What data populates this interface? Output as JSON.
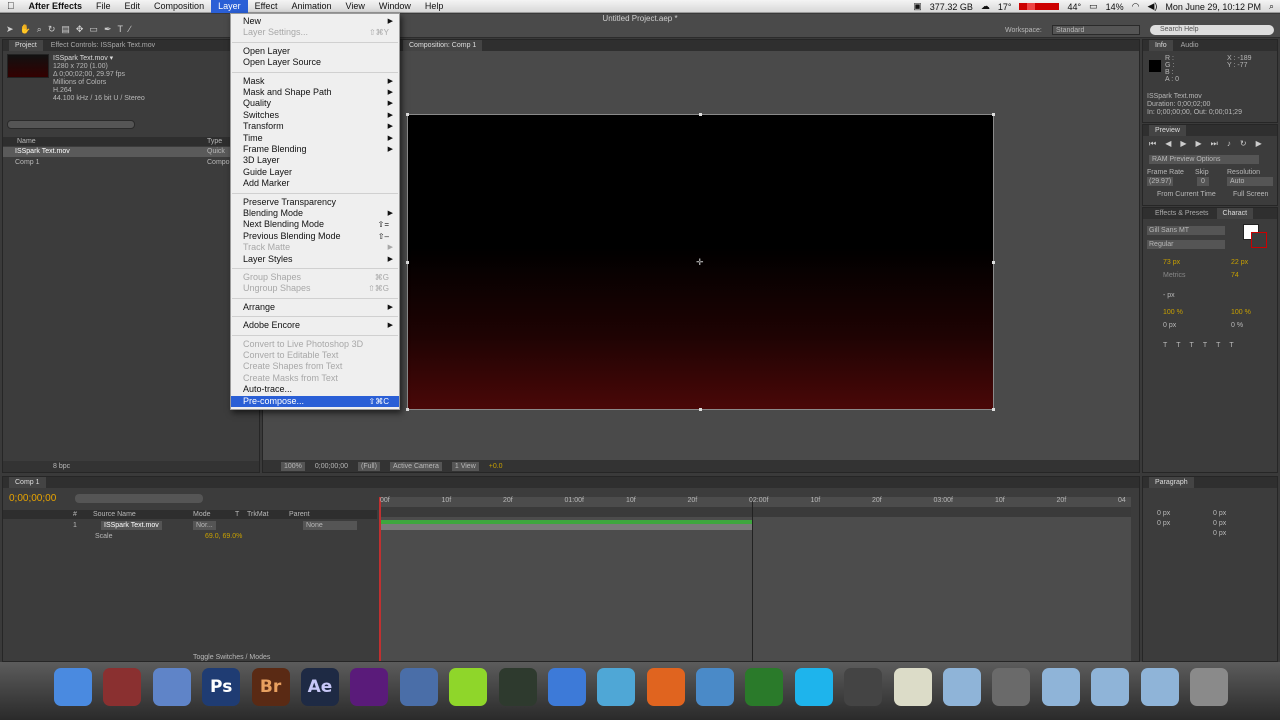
{
  "menubar": {
    "apple": "",
    "items": [
      "After Effects",
      "File",
      "Edit",
      "Composition",
      "Layer",
      "Effect",
      "Animation",
      "View",
      "Window",
      "Help"
    ],
    "active_index": 4,
    "disk": "377.32 GB",
    "temp": "17°",
    "temp2": "44°",
    "battery": "14%",
    "clock": "Mon June 29, 10:12 PM"
  },
  "toolbar": {
    "doc_title": "Untitled Project.aep *",
    "workspace_label": "Workspace:",
    "workspace_value": "Standard",
    "search_placeholder": "Search Help"
  },
  "project_panel": {
    "tab1": "Project",
    "tab2": "Effect Controls: ISSpark Text.mov",
    "asset_name": "ISSpark Text.mov ▾",
    "asset_info": [
      "1280 x 720 (1.00)",
      "Δ 0;00;02;00, 29.97 fps",
      "Millions of Colors",
      "H.264",
      "44.100 kHz / 16 bit U / Stereo"
    ],
    "col_name": "Name",
    "col_type": "Type",
    "items": [
      {
        "name": "ISSpark Text.mov",
        "type": "Quick"
      },
      {
        "name": "Comp 1",
        "type": "Compo"
      }
    ],
    "bpc": "8 bpc"
  },
  "comp_panel": {
    "tab": "Composition: Comp 1",
    "zoom": "100%",
    "timecode": "0;00;00;00",
    "resolution": "(Full)",
    "camera": "Active Camera",
    "view": "1 View",
    "offset": "+0.0"
  },
  "layer_menu": {
    "items": [
      {
        "label": "New",
        "sub": true
      },
      {
        "label": "Layer Settings...",
        "shortcut": "⇧⌘Y",
        "disabled": true
      },
      {
        "sep": true
      },
      {
        "label": "Open Layer"
      },
      {
        "label": "Open Layer Source"
      },
      {
        "sep": true
      },
      {
        "label": "Mask",
        "sub": true
      },
      {
        "label": "Mask and Shape Path",
        "sub": true
      },
      {
        "label": "Quality",
        "sub": true
      },
      {
        "label": "Switches",
        "sub": true
      },
      {
        "label": "Transform",
        "sub": true
      },
      {
        "label": "Time",
        "sub": true
      },
      {
        "label": "Frame Blending",
        "sub": true
      },
      {
        "label": "3D Layer"
      },
      {
        "label": "Guide Layer"
      },
      {
        "label": "Add Marker"
      },
      {
        "sep": true
      },
      {
        "label": "Preserve Transparency"
      },
      {
        "label": "Blending Mode",
        "sub": true
      },
      {
        "label": "Next Blending Mode",
        "shortcut": "⇧="
      },
      {
        "label": "Previous Blending Mode",
        "shortcut": "⇧–"
      },
      {
        "label": "Track Matte",
        "sub": true,
        "disabled": true
      },
      {
        "label": "Layer Styles",
        "sub": true
      },
      {
        "sep": true
      },
      {
        "label": "Group Shapes",
        "shortcut": "⌘G",
        "disabled": true
      },
      {
        "label": "Ungroup Shapes",
        "shortcut": "⇧⌘G",
        "disabled": true
      },
      {
        "sep": true
      },
      {
        "label": "Arrange",
        "sub": true
      },
      {
        "sep": true
      },
      {
        "label": "Adobe Encore",
        "sub": true
      },
      {
        "sep": true
      },
      {
        "label": "Convert to Live Photoshop 3D",
        "disabled": true
      },
      {
        "label": "Convert to Editable Text",
        "disabled": true
      },
      {
        "label": "Create Shapes from Text",
        "disabled": true
      },
      {
        "label": "Create Masks from Text",
        "disabled": true
      },
      {
        "label": "Auto-trace..."
      },
      {
        "label": "Pre-compose...",
        "shortcut": "⇧⌘C",
        "selected": true
      }
    ]
  },
  "info_panel": {
    "tab1": "Info",
    "tab2": "Audio",
    "rgba": [
      "R :",
      "G :",
      "B :",
      "A : 0"
    ],
    "xy": [
      "X : -189",
      "Y : -77"
    ],
    "clip": "ISSpark Text.mov",
    "duration": "Duration: 0;00;02;00",
    "inout": "In: 0;00;00;00, Out: 0;00;01;29"
  },
  "preview_panel": {
    "tab": "Preview",
    "ram": "RAM Preview Options",
    "frame_rate_label": "Frame Rate",
    "skip_label": "Skip",
    "resolution_label": "Resolution",
    "frame_rate": "(29.97)",
    "skip": "0",
    "resolution": "Auto",
    "from_current": "From Current Time",
    "full_screen": "Full Screen"
  },
  "character_panel": {
    "tab1": "Effects & Presets",
    "tab2": "Charact",
    "font": "Gill Sans MT",
    "style": "Regular",
    "size": "73 px",
    "leading": "22 px",
    "kerning": "Metrics",
    "tracking": "74",
    "stroke": "- px",
    "vscale": "100 %",
    "hscale": "100 %",
    "baseline": "0 px",
    "tsume": "0 %"
  },
  "timeline": {
    "tab": "Comp 1",
    "timecode": "0;00;00;00",
    "cols": [
      "#",
      "Source Name",
      "Mode",
      "T",
      "TrkMat",
      "Parent"
    ],
    "layer_num": "1",
    "layer_name": "ISSpark Text.mov",
    "layer_mode": "Nor...",
    "layer_parent": "None",
    "prop_name": "Scale",
    "prop_value": "69.0, 69.0%",
    "ruler": [
      "00f",
      "10f",
      "20f",
      "01:00f",
      "10f",
      "20f",
      "02:00f",
      "10f",
      "20f",
      "03:00f",
      "10f",
      "20f",
      "04"
    ],
    "toggle": "Toggle Switches / Modes"
  },
  "paragraph_panel": {
    "tab": "Paragraph",
    "values": [
      "0 px",
      "0 px",
      "0 px",
      "0 px",
      "0 px"
    ]
  },
  "dock": {
    "icons": [
      "finder-icon",
      "photo-booth-icon",
      "iphoto-icon",
      "photoshop-icon",
      "bridge-icon",
      "after-effects-icon",
      "app-purple-icon",
      "preview-icon",
      "lime-icon",
      "time-machine-icon",
      "safari-icon",
      "itunes-icon",
      "firefox-icon",
      "x11-icon",
      "globe-icon",
      "skype-icon",
      "spy-icon",
      "textedit-icon",
      "network-icon",
      "system-prefs-icon",
      "folder-1-icon",
      "folder-2-icon",
      "folder-3-icon",
      "trash-icon"
    ],
    "ps": "Ps",
    "br": "Br",
    "ae": "Ae"
  }
}
